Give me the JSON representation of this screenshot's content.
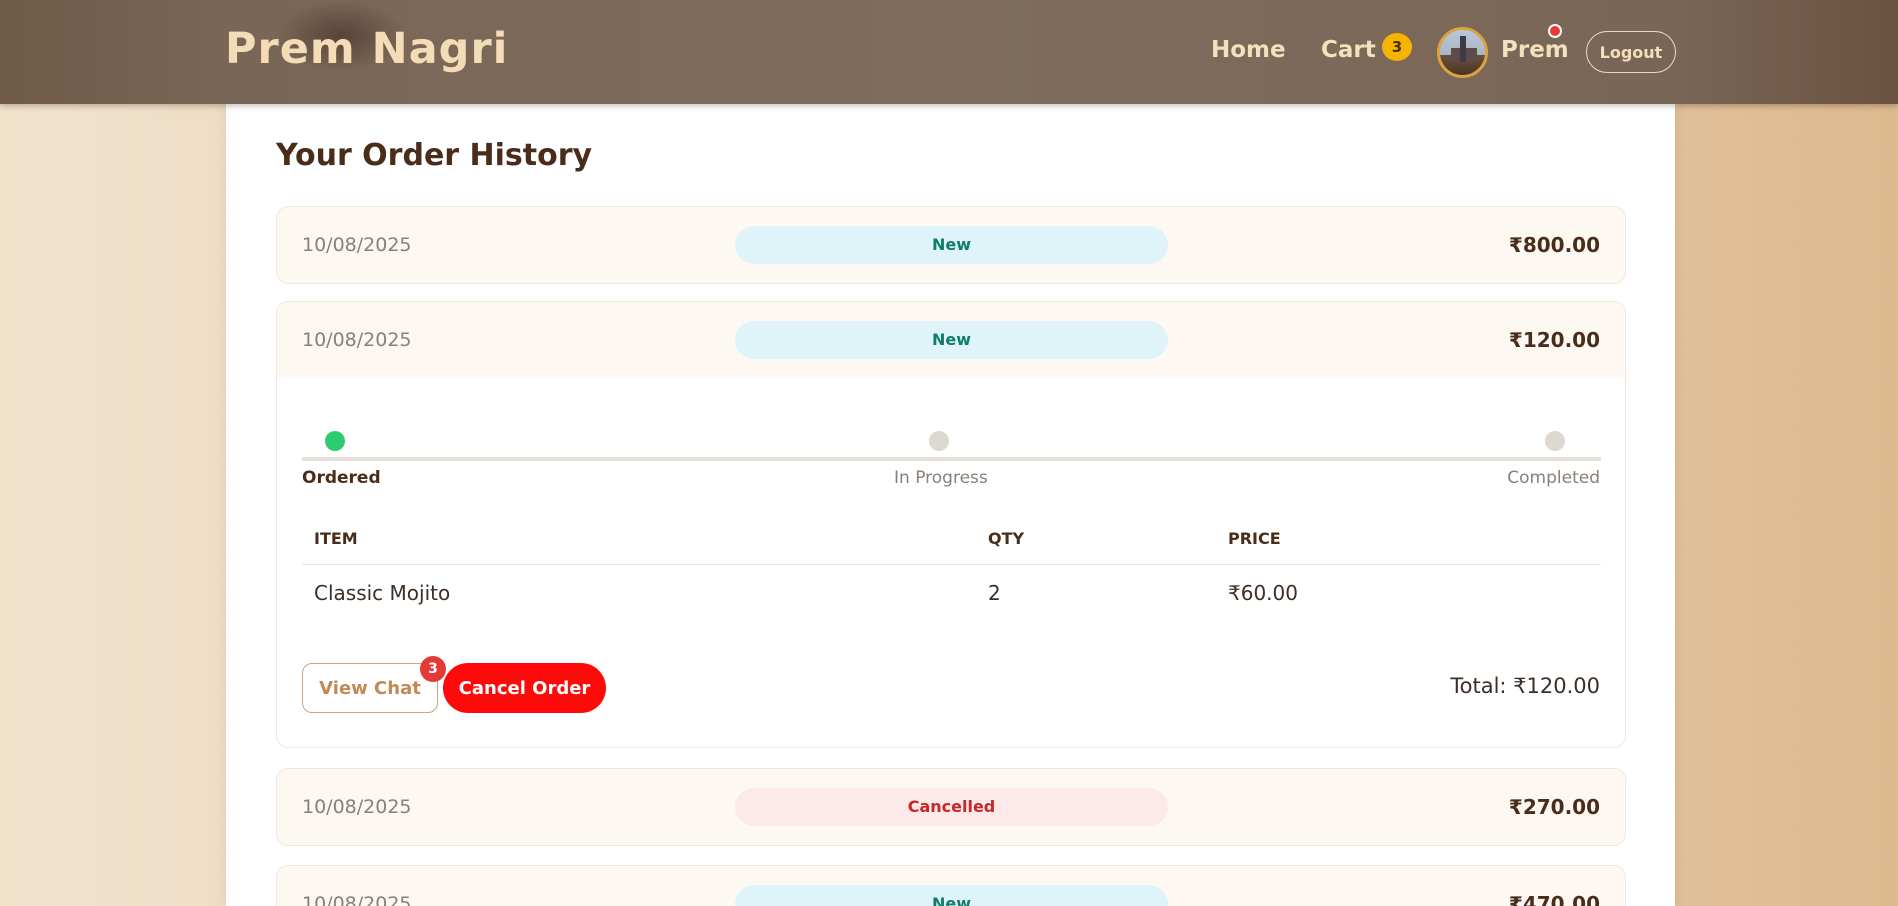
{
  "header": {
    "brand": "Prem Nagri",
    "nav": {
      "home": "Home",
      "cart": "Cart",
      "cart_count": "3"
    },
    "profile": {
      "name": "Prem",
      "avatar_icon": "avatar-icon",
      "notification_color": "#e53935"
    },
    "logout": "Logout"
  },
  "main": {
    "title": "Your Order History",
    "orders": [
      {
        "date": "10/08/2025",
        "status": "New",
        "total": "₹800.00"
      },
      {
        "date": "10/08/2025",
        "status": "New",
        "total": "₹120.00",
        "expanded": true,
        "steps": [
          {
            "label": "Ordered",
            "done": true
          },
          {
            "label": "In Progress",
            "done": false
          },
          {
            "label": "Completed",
            "done": false
          }
        ],
        "columns": [
          "ITEM",
          "QTY",
          "PRICE"
        ],
        "items": [
          {
            "item": "Classic Mojito",
            "qty": "2",
            "price": "₹60.00"
          }
        ],
        "actions": {
          "view_chat": "View Chat",
          "chat_unread": "3",
          "cancel": "Cancel Order"
        },
        "grand_total": "Total: ₹120.00"
      },
      {
        "date": "10/08/2025",
        "status": "Cancelled",
        "total": "₹270.00"
      },
      {
        "date": "10/08/2025",
        "status": "New",
        "total": "₹470.00"
      }
    ]
  },
  "colors": {
    "accent_brown": "#4a2c1a",
    "status_new_bg": "#dff4f8",
    "status_new_text": "#0e7d69",
    "status_cancelled_bg": "#fde8ea",
    "status_cancelled_text": "#c62828",
    "cancel_button": "#ff0a0a",
    "step_done": "#2ecc71"
  }
}
